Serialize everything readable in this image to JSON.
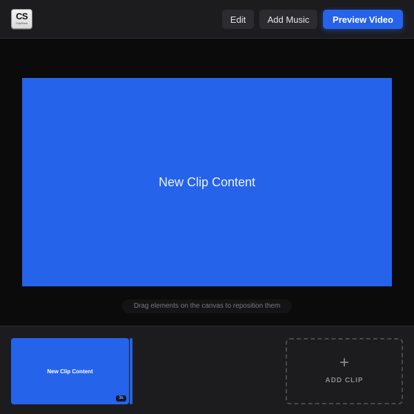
{
  "header": {
    "logo": {
      "mark": "CS",
      "sub": "ClipShow"
    },
    "edit_label": "Edit",
    "add_music_label": "Add Music",
    "preview_label": "Preview Video"
  },
  "stage": {
    "canvas_text": "New Clip Content",
    "hint": "Drag elements on the canvas to reposition them"
  },
  "timeline": {
    "clips": [
      {
        "label": "New Clip Content",
        "duration": "3s"
      }
    ],
    "add_clip_icon": "+",
    "add_clip_label": "ADD CLIP"
  },
  "colors": {
    "accent": "#2563eb",
    "background": "#0b0b0b",
    "panel": "#1c1c1f"
  },
  "icons": {
    "add_clip": "plus-icon"
  }
}
